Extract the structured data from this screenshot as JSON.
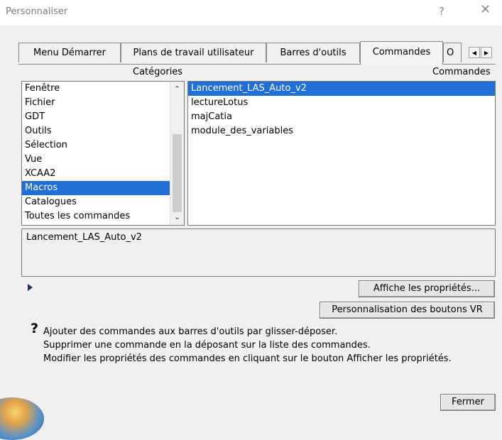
{
  "window": {
    "title": "Personnaliser",
    "help_glyph": "?",
    "close_glyph": "✕"
  },
  "tabs": [
    {
      "label": "Menu Démarrer",
      "active": false
    },
    {
      "label": "Plans de travail utilisateur",
      "active": false
    },
    {
      "label": "Barres d'outils",
      "active": false
    },
    {
      "label": "Commandes",
      "active": true
    },
    {
      "label": "O",
      "active": false
    }
  ],
  "tab_scroll": {
    "left_icon": "◀",
    "right_icon": "▶"
  },
  "categories": {
    "header": "Catégories",
    "items": [
      "Fenêtre",
      "Fichier",
      "GDT",
      "Outils",
      "Sélection",
      "Vue",
      "XCAA2",
      "Macros",
      "Catalogues",
      "Toutes les commandes"
    ],
    "selected": "Macros",
    "scroll_up": "⌃",
    "scroll_down": "⌄"
  },
  "commands": {
    "header": "Commandes",
    "items": [
      "Lancement_LAS_Auto_v2",
      "lectureLotus",
      "majCatia",
      "module_des_variables"
    ],
    "selected": "Lancement_LAS_Auto_v2"
  },
  "description": "Lancement_LAS_Auto_v2",
  "buttons": {
    "properties": "Affiche les propriétés...",
    "vr": "Personnalisation des boutons VR",
    "close": "Fermer"
  },
  "help": {
    "icon": "?",
    "lines": [
      "Ajouter des commandes aux barres d'outils par glisser-déposer.",
      "Supprimer une commande en la déposant sur la liste des commandes.",
      "Modifier les propriétés des commandes en cliquant sur le bouton Afficher les propriétés."
    ]
  },
  "colors": {
    "selection": "#1f6fd6",
    "dialog_bg": "#f0f0f0"
  }
}
